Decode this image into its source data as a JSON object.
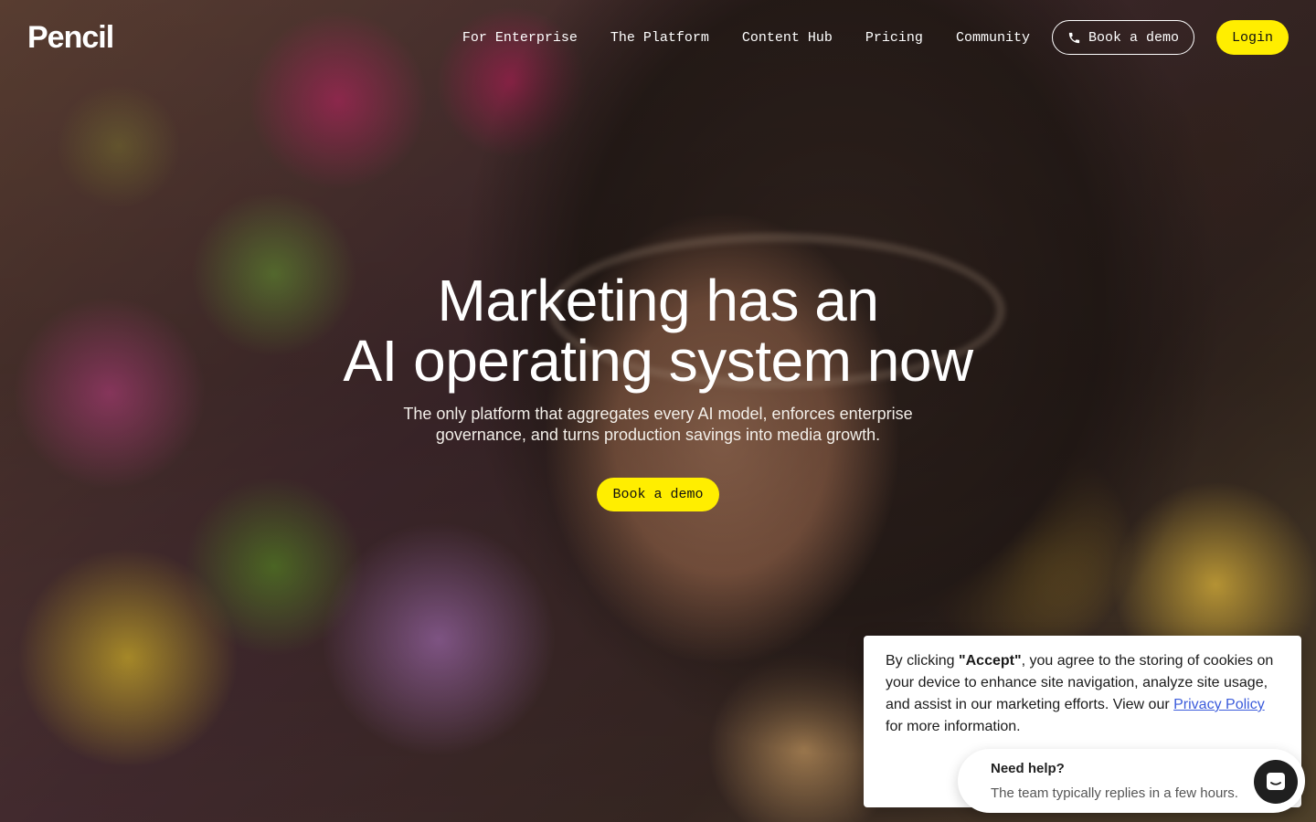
{
  "brand": {
    "logo_text": "Pencil"
  },
  "nav": {
    "items": [
      {
        "label": "For Enterprise"
      },
      {
        "label": "The Platform"
      },
      {
        "label": "Content Hub"
      },
      {
        "label": "Pricing"
      },
      {
        "label": "Community"
      }
    ],
    "book_demo_label": "Book a demo",
    "login_label": "Login"
  },
  "hero": {
    "title_line1": "Marketing has an",
    "title_line2": "AI operating system now",
    "subtitle_line1": "The only platform that aggregates every AI model, enforces enterprise",
    "subtitle_line2": "governance, and turns production savings into media growth.",
    "cta_label": "Book a demo"
  },
  "cookie": {
    "text_before": "By clicking ",
    "bold": "\"Accept\"",
    "text_after": ", you agree to the storing of cookies on your device to enhance site navigation, analyze site usage, and assist in our marketing efforts. View our ",
    "link_label": "Privacy Policy",
    "text_end": " for more information."
  },
  "chat": {
    "title": "Need help?",
    "subtitle": "The team typically replies in a few hours."
  },
  "colors": {
    "accent_yellow": "#ffee00",
    "link_blue": "#3b5bdb",
    "text_white": "#ffffff"
  },
  "icons": {
    "phone": "phone-icon",
    "chat": "chat-icon"
  }
}
